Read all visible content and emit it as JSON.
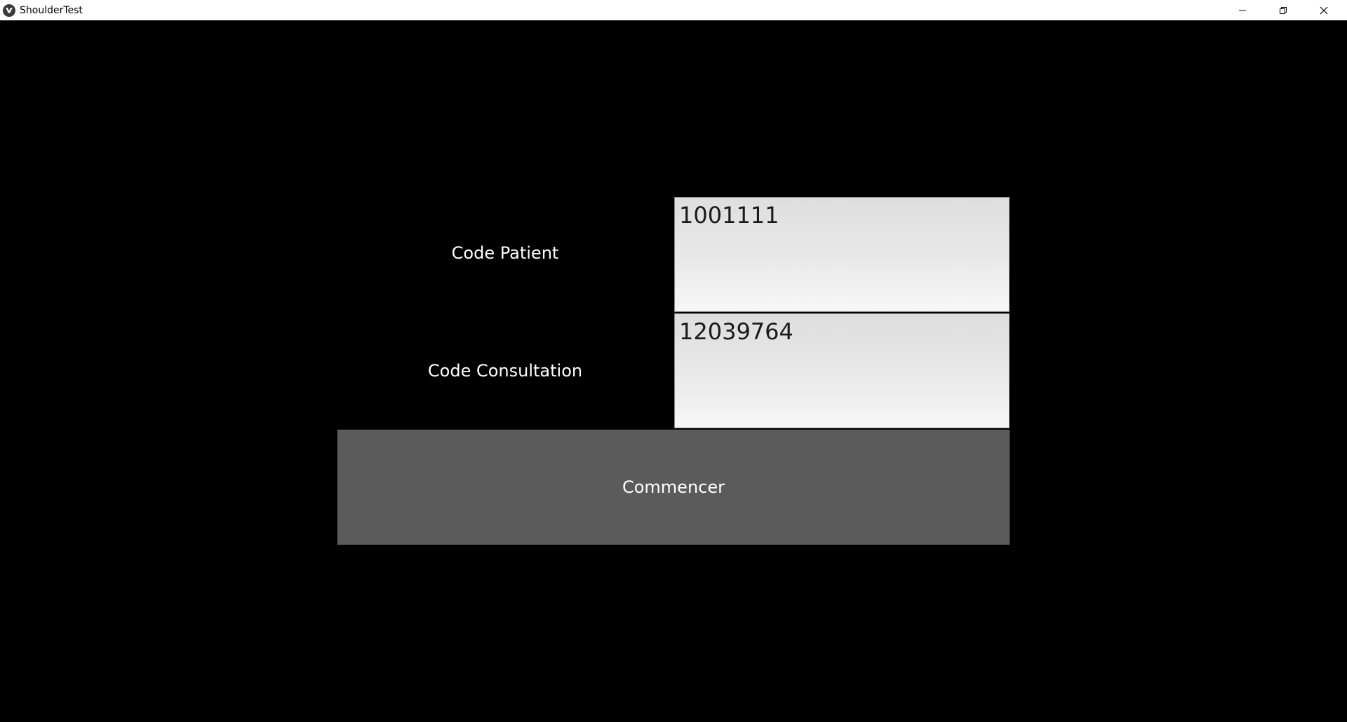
{
  "window": {
    "title": "ShoulderTest",
    "app_icon": "kivy-logo-icon",
    "controls": {
      "minimize_icon": "minimize-icon",
      "restore_icon": "restore-icon",
      "close_icon": "close-icon"
    }
  },
  "form": {
    "patient": {
      "label": "Code Patient",
      "value": "1001111"
    },
    "consultation": {
      "label": "Code Consultation",
      "value": "12039764"
    },
    "start_button_label": "Commencer"
  },
  "colors": {
    "background": "#000000",
    "button": "#5b5b5b",
    "input": "#e9e9e9",
    "text_light": "#ffffff"
  }
}
